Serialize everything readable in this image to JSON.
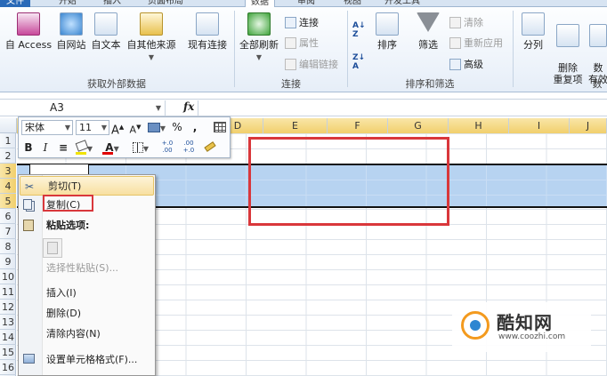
{
  "tabs": [
    {
      "label": "文件"
    },
    {
      "label": "开始"
    },
    {
      "label": "插入"
    },
    {
      "label": "页面布局"
    },
    {
      "label": "数据"
    },
    {
      "label": "审阅"
    },
    {
      "label": "视图"
    },
    {
      "label": "开发工具"
    }
  ],
  "ribbon": {
    "external": {
      "label": "获取外部数据",
      "access": "自 Access",
      "web": "自网站",
      "text": "自文本",
      "other": "自其他来源",
      "existing": "现有连接"
    },
    "connections": {
      "label": "连接",
      "refresh": "全部刷新",
      "conn": "连接",
      "props": "属性",
      "editlinks": "编辑链接"
    },
    "sortfilter": {
      "label": "排序和筛选",
      "sort": "排序",
      "filter": "筛选",
      "clear": "清除",
      "reapply": "重新应用",
      "advanced": "高级"
    },
    "tools": {
      "label": "数",
      "split": "分列",
      "remove_dup": "删除\n重复项",
      "data_valid": "数\n有效"
    }
  },
  "formula_bar": {
    "name_box": "A3",
    "fx": "fx",
    "value": ""
  },
  "columns": [
    "D",
    "E",
    "F",
    "G",
    "H",
    "I",
    "J"
  ],
  "rows": [
    "1",
    "2",
    "3",
    "4",
    "5",
    "6",
    "7",
    "8",
    "9",
    "10",
    "11",
    "12",
    "13",
    "14",
    "15",
    "16"
  ],
  "mini_toolbar": {
    "font": "宋体",
    "size": "11",
    "grow": "A",
    "shrink": "A",
    "percent": "%",
    "comma": ",",
    "bold": "B",
    "italic": "I",
    "align": "≡",
    "font_color_letter": "A",
    "inc_decimal": "+.0\n.00",
    "dec_decimal": ".00\n+.0"
  },
  "context_menu": {
    "cut": "剪切(T)",
    "copy": "复制(C)",
    "paste_options": "粘贴选项:",
    "paste_special": "选择性粘贴(S)...",
    "insert": "插入(I)",
    "delete": "删除(D)",
    "clear": "清除内容(N)",
    "format": "设置单元格格式(F)..."
  },
  "watermark": {
    "title": "酷知网",
    "url": "www.coozhi.com"
  },
  "colors": {
    "accent_red": "#d9373b",
    "selection": "#b7d3f1",
    "file_tab": "#2a6ab8"
  }
}
